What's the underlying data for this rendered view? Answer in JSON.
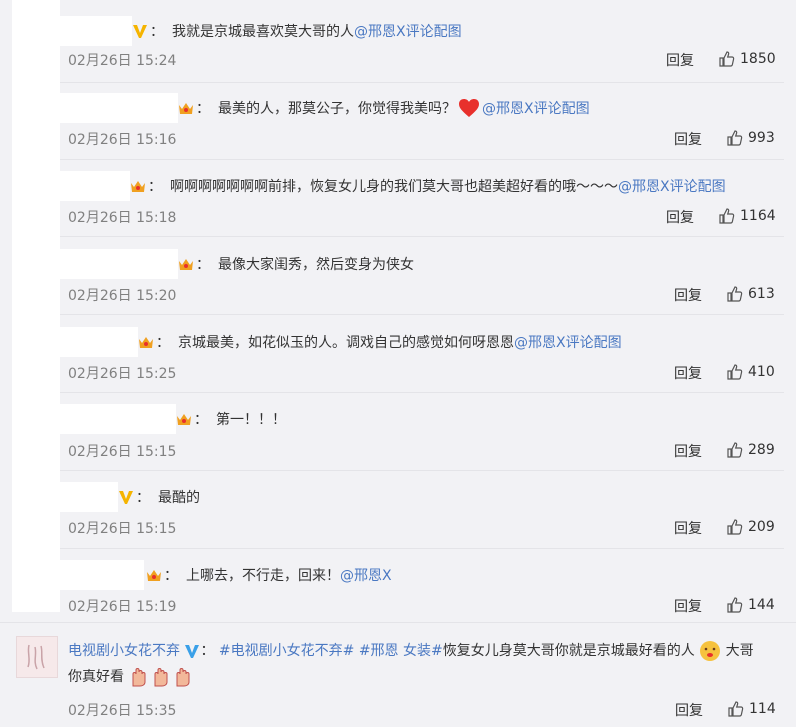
{
  "comments": [
    {
      "text": "我就是京城最喜欢莫大哥的人",
      "mention": "@邢恩X",
      "suffix": " 评论配图",
      "date": "02月26日 15:24",
      "reply": "回复",
      "likes": "1850",
      "badge": "verified"
    },
    {
      "text": "最美的人，那莫公子，你觉得我美吗？",
      "mention": "@邢恩X",
      "suffix": " 评论配图",
      "date": "02月26日 15:16",
      "reply": "回复",
      "likes": "993",
      "badge": "crown"
    },
    {
      "text": "啊啊啊啊啊啊啊前排，恢复女儿身的我们莫大哥也超美超好看的哦～～～",
      "mention": "@邢恩X",
      "suffix": " 评论配图",
      "date": "02月26日 15:18",
      "reply": "回复",
      "likes": "1164",
      "badge": "crown"
    },
    {
      "text": "最像大家闺秀，然后变身为侠女",
      "mention": "",
      "suffix": "",
      "date": "02月26日 15:20",
      "reply": "回复",
      "likes": "613",
      "badge": "crown"
    },
    {
      "text": "京城最美，如花似玉的人。调戏自己的感觉如何呀恩恩",
      "mention": "@邢恩X",
      "suffix": " 评论配图",
      "date": "02月26日 15:25",
      "reply": "回复",
      "likes": "410",
      "badge": "crown"
    },
    {
      "text": "第一！！！",
      "mention": "",
      "suffix": "",
      "date": "02月26日 15:15",
      "reply": "回复",
      "likes": "289",
      "badge": "crown"
    },
    {
      "text": "最酷的",
      "mention": "",
      "suffix": "",
      "date": "02月26日 15:15",
      "reply": "回复",
      "likes": "209",
      "badge": "verified"
    },
    {
      "text": "上哪去，不行走，回来！",
      "mention": "@邢恩X",
      "suffix": "",
      "date": "02月26日 15:19",
      "reply": "回复",
      "likes": "144",
      "badge": "crown"
    }
  ],
  "last": {
    "username": "电视剧小女花不弃",
    "tag1": "#电视剧小女花不弃#",
    "tag2": "#邢恩 女装#",
    "text": "恢复女儿身莫大哥你就是京城最好看的人",
    "text2": "大哥",
    "text3": "你真好看",
    "date": "02月26日 15:35",
    "reply": "回复",
    "likes": "114"
  },
  "colors": {
    "link": "#4a78c2",
    "meta": "#808080",
    "crown": "#f0a020",
    "verified": "#f5b400",
    "heart": "#e8302c"
  }
}
